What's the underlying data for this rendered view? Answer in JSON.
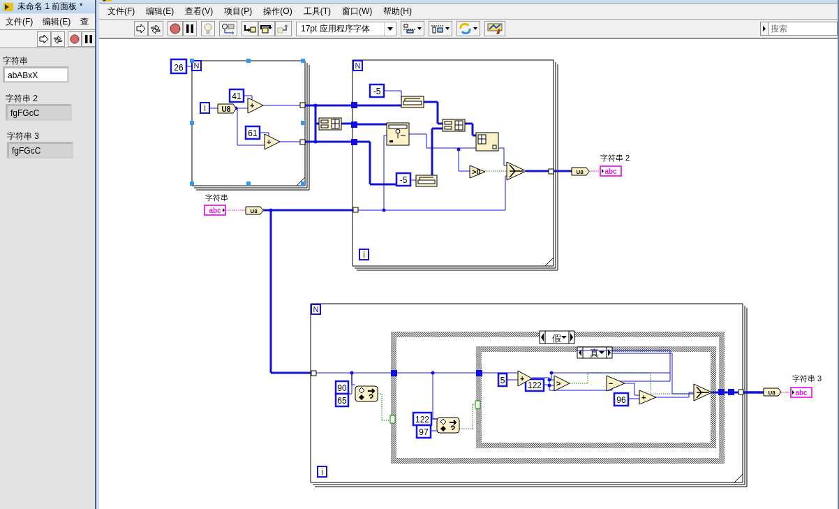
{
  "front_panel": {
    "title": "未命名 1 前面板 *",
    "menu": [
      "文件(F)",
      "编辑(E)",
      "查"
    ],
    "controls": [
      {
        "kind": "control",
        "label": "字符串",
        "value": "abABxX"
      },
      {
        "kind": "indicator",
        "label": "字符串 2",
        "value": "fgFGcC"
      },
      {
        "kind": "indicator",
        "label": "字符串 3",
        "value": "fgFGcC"
      }
    ]
  },
  "block_diagram": {
    "menu": [
      "文件(F)",
      "编辑(E)",
      "查看(V)",
      "项目(P)",
      "操作(O)",
      "工具(T)",
      "窗口(W)",
      "帮助(H)"
    ],
    "font": "17pt 应用程序字体",
    "search": {
      "placeholder": "搜索"
    },
    "loops": [
      {
        "count": "N",
        "iteration": "i"
      },
      {
        "count": "N",
        "iteration": "i"
      },
      {
        "count": "N",
        "iteration": "i"
      }
    ],
    "constants": [
      "26",
      "41",
      "61",
      "-5",
      "-5",
      "90",
      "65",
      "122",
      "97",
      "5",
      "122",
      "96"
    ],
    "operators": [
      "+",
      "+",
      ">0",
      "+",
      ">",
      "−",
      "+"
    ],
    "conversions": [
      "U8",
      "U8",
      "U8",
      "U8"
    ],
    "terminals": [
      {
        "kind": "control",
        "label": "字符串",
        "text": "abc"
      },
      {
        "kind": "indicator",
        "label": "字符串 2",
        "text": "abc"
      },
      {
        "kind": "indicator",
        "label": "字符串 3",
        "text": "abc"
      }
    ],
    "case_selectors": [
      "假",
      "真"
    ]
  }
}
